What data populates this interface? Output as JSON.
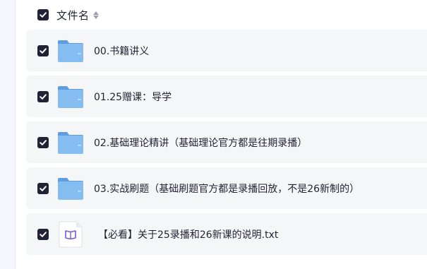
{
  "header": {
    "label": "文件名",
    "select_all_checked": true
  },
  "files": [
    {
      "name": "00.书籍讲义",
      "type": "folder",
      "checked": true
    },
    {
      "name": "01.25赠课：导学",
      "type": "folder",
      "checked": true
    },
    {
      "name": "02.基础理论精讲（基础理论官方都是往期录播）",
      "type": "folder",
      "checked": true
    },
    {
      "name": "03.实战刷题（基础刷题官方都是录播回放，不是26新制的）",
      "type": "folder",
      "checked": true
    },
    {
      "name": "【必看】关于25录播和26新课的说明.txt",
      "type": "txt",
      "checked": true
    }
  ],
  "colors": {
    "checkbox": "#1f2333",
    "row_bg": "#f5f6f8",
    "folder": "#7fb7ee",
    "txt_accent": "#7b5ad6"
  }
}
